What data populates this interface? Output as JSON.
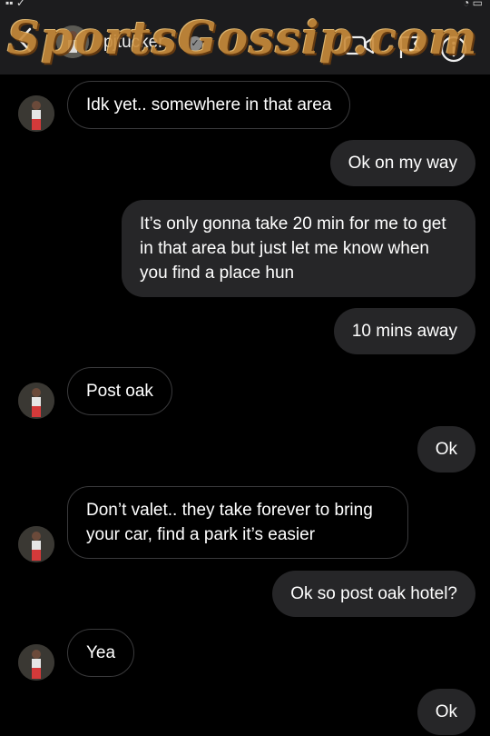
{
  "header": {
    "username": "pjtucker",
    "watermark": "SportsGossip.com"
  },
  "icons": {
    "back": "chevron-left-icon",
    "video": "video-camera-icon",
    "flag": "flag-icon",
    "info": "info-icon",
    "verified": "verified-badge-icon"
  },
  "colors": {
    "background": "#000000",
    "sent_bubble": "#262628",
    "received_border": "#3a3a3c",
    "header": "#1c1c1e"
  },
  "messages": [
    {
      "from": "them",
      "text": "Idk yet.. somewhere in that area"
    },
    {
      "from": "me",
      "text": "Ok on my way"
    },
    {
      "from": "me",
      "text": "It’s only gonna take 20 min for me to get in that area but just let me know when you find a place hun"
    },
    {
      "from": "me",
      "text": "10 mins away"
    },
    {
      "from": "them",
      "text": "Post oak"
    },
    {
      "from": "me",
      "text": "Ok"
    },
    {
      "from": "them",
      "text": "Don’t valet.. they take forever to bring your car, find a park it’s easier"
    },
    {
      "from": "me",
      "text": "Ok so post oak hotel?"
    },
    {
      "from": "them",
      "text": "Yea"
    },
    {
      "from": "me",
      "text": "Ok"
    }
  ]
}
